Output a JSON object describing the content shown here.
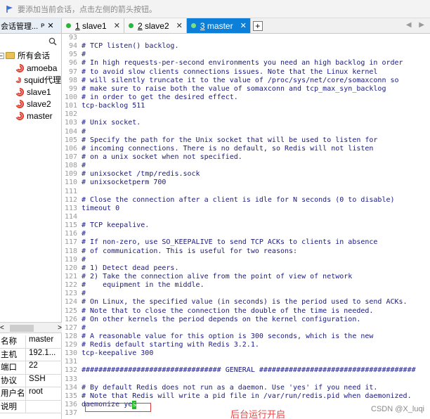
{
  "topbar": {
    "hint": "要添加当前会话，点击左侧的箭头按钮。"
  },
  "sidebar": {
    "title": "会话管理...",
    "pin": "ᴘ",
    "close": "✕",
    "root_label": "所有会话",
    "root_expander": "−",
    "sessions": [
      "amoeba",
      "squid代理",
      "slave1",
      "slave2",
      "master"
    ]
  },
  "props": {
    "rows": [
      {
        "k": "名称",
        "v": "master"
      },
      {
        "k": "主机",
        "v": "192.1..."
      },
      {
        "k": "端口",
        "v": "22"
      },
      {
        "k": "协议",
        "v": "SSH"
      },
      {
        "k": "用户名",
        "v": "root"
      },
      {
        "k": "说明",
        "v": ""
      }
    ]
  },
  "tabs": [
    {
      "num": "1",
      "label": "slave1",
      "close": "✕"
    },
    {
      "num": "2",
      "label": "slave2",
      "close": "✕"
    },
    {
      "num": "3",
      "label": "master",
      "close": "✕"
    }
  ],
  "tab_add": "+",
  "tab_nav": "◀ ▶",
  "editor": {
    "lines": [
      {
        "n": "93",
        "t": ""
      },
      {
        "n": "94",
        "t": "# TCP listen() backlog."
      },
      {
        "n": "95",
        "t": "#"
      },
      {
        "n": "96",
        "t": "# In high requests-per-second environments you need an high backlog in order"
      },
      {
        "n": "97",
        "t": "# to avoid slow clients connections issues. Note that the Linux kernel"
      },
      {
        "n": "98",
        "t": "# will silently truncate it to the value of /proc/sys/net/core/somaxconn so"
      },
      {
        "n": "99",
        "t": "# make sure to raise both the value of somaxconn and tcp_max_syn_backlog"
      },
      {
        "n": "100",
        "t": "# in order to get the desired effect."
      },
      {
        "n": "101",
        "t": "tcp-backlog 511"
      },
      {
        "n": "102",
        "t": ""
      },
      {
        "n": "103",
        "t": "# Unix socket."
      },
      {
        "n": "104",
        "t": "#"
      },
      {
        "n": "105",
        "t": "# Specify the path for the Unix socket that will be used to listen for"
      },
      {
        "n": "106",
        "t": "# incoming connections. There is no default, so Redis will not listen"
      },
      {
        "n": "107",
        "t": "# on a unix socket when not specified."
      },
      {
        "n": "108",
        "t": "#"
      },
      {
        "n": "109",
        "t": "# unixsocket /tmp/redis.sock"
      },
      {
        "n": "110",
        "t": "# unixsocketperm 700"
      },
      {
        "n": "111",
        "t": ""
      },
      {
        "n": "112",
        "t": "# Close the connection after a client is idle for N seconds (0 to disable)"
      },
      {
        "n": "113",
        "t": "timeout 0"
      },
      {
        "n": "114",
        "t": ""
      },
      {
        "n": "115",
        "t": "# TCP keepalive."
      },
      {
        "n": "116",
        "t": "#"
      },
      {
        "n": "117",
        "t": "# If non-zero, use SO_KEEPALIVE to send TCP ACKs to clients in absence"
      },
      {
        "n": "118",
        "t": "# of communication. This is useful for two reasons:"
      },
      {
        "n": "119",
        "t": "#"
      },
      {
        "n": "120",
        "t": "# 1) Detect dead peers."
      },
      {
        "n": "121",
        "t": "# 2) Take the connection alive from the point of view of network"
      },
      {
        "n": "122",
        "t": "#    equipment in the middle."
      },
      {
        "n": "123",
        "t": "#"
      },
      {
        "n": "124",
        "t": "# On Linux, the specified value (in seconds) is the period used to send ACKs."
      },
      {
        "n": "125",
        "t": "# Note that to close the connection the double of the time is needed."
      },
      {
        "n": "126",
        "t": "# On other kernels the period depends on the kernel configuration."
      },
      {
        "n": "127",
        "t": "#"
      },
      {
        "n": "128",
        "t": "# A reasonable value for this option is 300 seconds, which is the new"
      },
      {
        "n": "129",
        "t": "# Redis default starting with Redis 3.2.1."
      },
      {
        "n": "130",
        "t": "tcp-keepalive 300"
      },
      {
        "n": "131",
        "t": ""
      },
      {
        "n": "132",
        "t": "################################# GENERAL #####################################"
      },
      {
        "n": "133",
        "t": ""
      },
      {
        "n": "134",
        "t": "# By default Redis does not run as a daemon. Use 'yes' if you need it."
      },
      {
        "n": "135",
        "t": "# Note that Redis will write a pid file in /var/run/redis.pid when daemonized."
      },
      {
        "n": "136",
        "t": "daemonize ye"
      },
      {
        "n": "137",
        "t": ""
      }
    ],
    "cursor_char": "s"
  },
  "annotation": "后台运行开启",
  "watermark": "CSDN @X_luqi",
  "colors": {
    "active_tab": "#0c7fd8",
    "status_dot": "#2bb63a",
    "annotation": "#e94343"
  }
}
